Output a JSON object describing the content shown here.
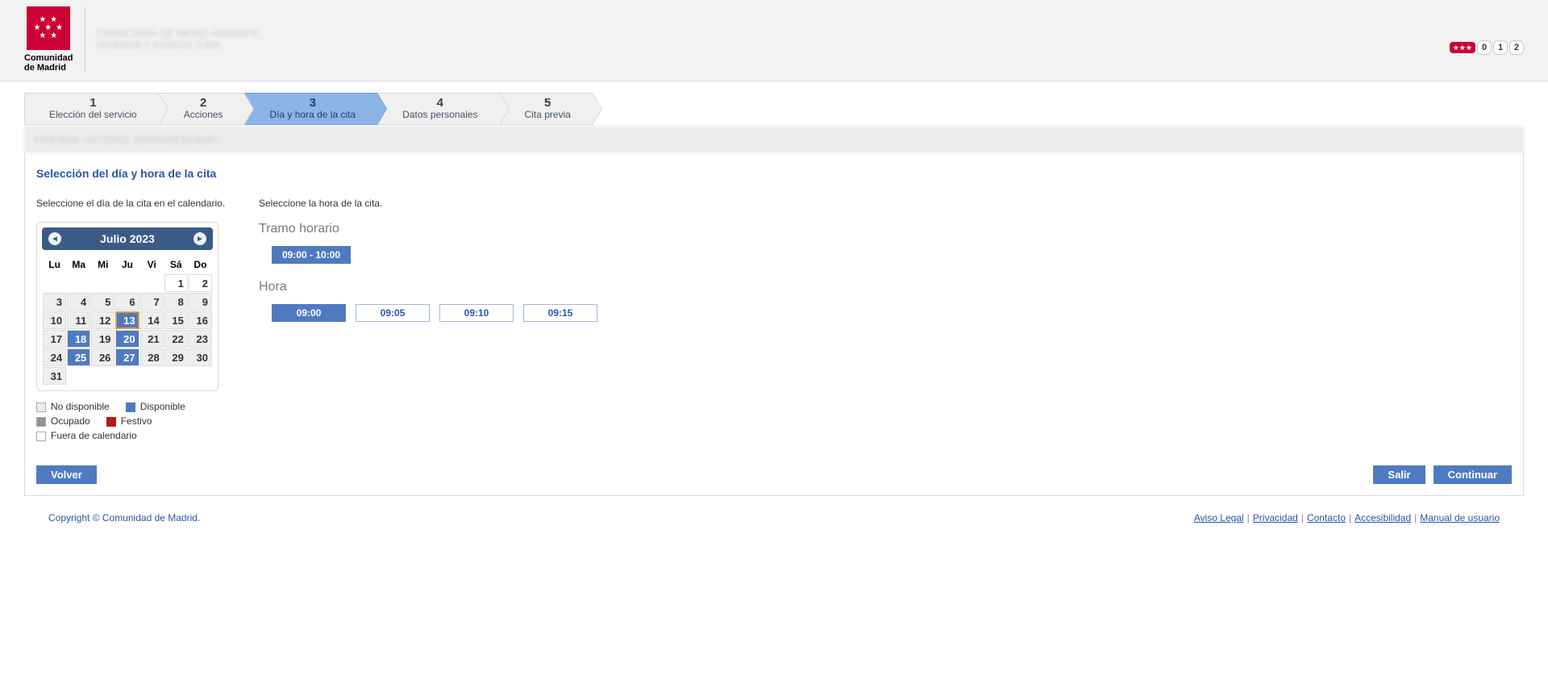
{
  "brand": {
    "line1": "Comunidad",
    "line2": "de Madrid"
  },
  "header": {
    "dept_line1": "CONSEJERÍA DE MEDIO AMBIENTE,",
    "dept_line2": "VIVIENDA Y AGRICULTURA",
    "counters": [
      "0",
      "1",
      "2"
    ]
  },
  "steps": [
    {
      "num": "1",
      "label": "Elección del servicio"
    },
    {
      "num": "2",
      "label": "Acciones"
    },
    {
      "num": "3",
      "label": "Día y hora de la cita"
    },
    {
      "num": "4",
      "label": "Datos personales"
    },
    {
      "num": "5",
      "label": "Cita previa"
    }
  ],
  "active_step_index": 2,
  "crumb": "VIVIENDA › AUTORIZ. VENTA/DESCALIFI.",
  "section_title": "Selección del día y hora de la cita",
  "left_caption": "Seleccione el día de la cita en el calendario.",
  "right_caption": "Seleccione la hora de la cita.",
  "tramo_heading": "Tramo horario",
  "hora_heading": "Hora",
  "calendar": {
    "title": "Julio 2023",
    "dow": [
      "Lu",
      "Ma",
      "Mi",
      "Ju",
      "Vi",
      "Sá",
      "Do"
    ],
    "leading_blanks": 5,
    "days_in_month": 31,
    "out_of_calendar": [
      1,
      2
    ],
    "available": [
      13,
      18,
      20,
      25,
      27
    ],
    "selected": 13
  },
  "legend": {
    "no_disponible": "No disponible",
    "disponible": "Disponible",
    "ocupado": "Ocupado",
    "festivo": "Festivo",
    "fuera": "Fuera de calendario"
  },
  "tramos": [
    {
      "label": "09:00 - 10:00",
      "active": true
    }
  ],
  "horas": [
    {
      "label": "09:00",
      "active": true
    },
    {
      "label": "09:05",
      "active": false
    },
    {
      "label": "09:10",
      "active": false
    },
    {
      "label": "09:15",
      "active": false
    }
  ],
  "buttons": {
    "volver": "Volver",
    "salir": "Salir",
    "continuar": "Continuar"
  },
  "footer": {
    "copyright": "Copyright © Comunidad de Madrid.",
    "links": [
      "Aviso Legal",
      "Privacidad",
      "Contacto",
      "Accesibilidad",
      "Manual de usuario"
    ]
  }
}
